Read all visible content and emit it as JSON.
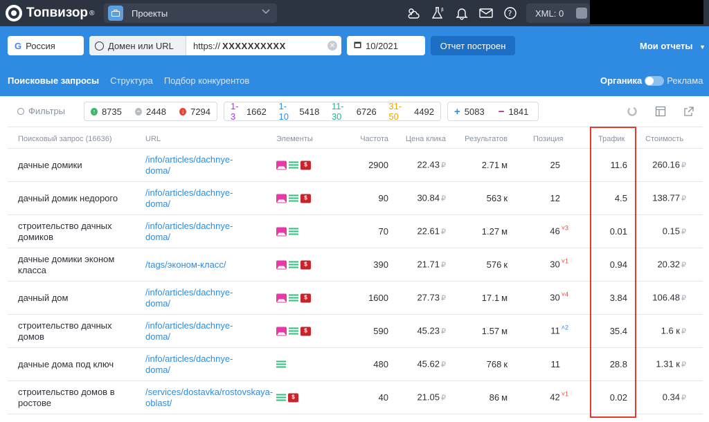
{
  "topbar": {
    "logo_text": "Топвизор",
    "logo_reg": "®",
    "project_label": "Проекты",
    "xml_label": "XML: 0",
    "icons": [
      "weather-icon",
      "flask-beta-icon",
      "bell-icon",
      "mail-icon",
      "help-icon"
    ]
  },
  "filterbar": {
    "country": "Россия",
    "domain_mode": "Домен или URL",
    "url_prefix": "https://",
    "url_value": "XXXXXXXXXX",
    "date": "10/2021",
    "report_button": "Отчет построен",
    "my_reports": "Мои отчеты"
  },
  "tabs": [
    {
      "label": "Поисковые запросы",
      "active": true
    },
    {
      "label": "Структура",
      "active": false
    },
    {
      "label": "Подбор конкурентов",
      "active": false
    }
  ],
  "toggle": {
    "left": "Органика",
    "right": "Реклама"
  },
  "summary": {
    "filters_label": "Фильтры",
    "up": "8735",
    "same": "2448",
    "down": "7294",
    "r1_3_label": "1-3",
    "r1_3": "1662",
    "r1_10_label": "1-10",
    "r1_10": "5418",
    "r11_30_label": "11-30",
    "r11_30": "6726",
    "r31_50_label": "31-50",
    "r31_50": "4492",
    "added": "5083",
    "removed": "1841"
  },
  "table": {
    "headers": {
      "query": "Поисковый запрос (16636)",
      "url": "URL",
      "elements": "Элементы",
      "frequency": "Частота",
      "cpc": "Цена клика",
      "results": "Результатов",
      "position": "Позиция",
      "traffic": "Трафик",
      "cost": "Стоимость"
    },
    "currency": "₽",
    "rows": [
      {
        "query": "дачные домики",
        "url": "/info/articles/dachnye-doma/",
        "elements": [
          "image",
          "text",
          "ad"
        ],
        "freq": "2900",
        "cpc": "22.43",
        "res_num": "2.71",
        "res_unit": "м",
        "pos": "25",
        "delta": "",
        "traffic": "11.6",
        "cost": "260.16"
      },
      {
        "query": "дачный домик недорого",
        "url": "/info/articles/dachnye-doma/",
        "elements": [
          "image",
          "text",
          "ad"
        ],
        "freq": "90",
        "cpc": "30.84",
        "res_num": "563",
        "res_unit": "к",
        "pos": "12",
        "delta": "",
        "traffic": "4.5",
        "cost": "138.77"
      },
      {
        "query": "строительство дачных домиков",
        "url": "/info/articles/dachnye-doma/",
        "elements": [
          "image",
          "text"
        ],
        "freq": "70",
        "cpc": "22.61",
        "res_num": "1.27",
        "res_unit": "м",
        "pos": "46",
        "delta": "˅3",
        "traffic": "0.01",
        "cost": "0.15"
      },
      {
        "query": "дачные домики эконом класса",
        "url": "/tags/эконом-класс/",
        "elements": [
          "image",
          "text",
          "ad"
        ],
        "freq": "390",
        "cpc": "21.71",
        "res_num": "576",
        "res_unit": "к",
        "pos": "30",
        "delta": "˅1",
        "traffic": "0.94",
        "cost": "20.32"
      },
      {
        "query": "дачный дом",
        "url": "/info/articles/dachnye-doma/",
        "elements": [
          "image",
          "text",
          "ad"
        ],
        "freq": "1600",
        "cpc": "27.73",
        "res_num": "17.1",
        "res_unit": "м",
        "pos": "30",
        "delta": "˅4",
        "traffic": "3.84",
        "cost": "106.48"
      },
      {
        "query": "строительство дачных домов",
        "url": "/info/articles/dachnye-doma/",
        "elements": [
          "image",
          "text",
          "ad"
        ],
        "freq": "590",
        "cpc": "45.23",
        "res_num": "1.57",
        "res_unit": "м",
        "pos": "11",
        "delta": "˄2",
        "traffic": "35.4",
        "cost": "1.6 к"
      },
      {
        "query": "дачные дома под ключ",
        "url": "/info/articles/dachnye-doma/",
        "elements": [
          "text"
        ],
        "freq": "480",
        "cpc": "45.62",
        "res_num": "768",
        "res_unit": "к",
        "pos": "11",
        "delta": "",
        "traffic": "28.8",
        "cost": "1.31 к"
      },
      {
        "query": "строительство домов в ростове",
        "url": "/services/dostavka/rostovskaya-oblast/",
        "elements": [
          "text",
          "ad"
        ],
        "freq": "40",
        "cpc": "21.05",
        "res_num": "86",
        "res_unit": "м",
        "pos": "42",
        "delta": "˅1",
        "traffic": "0.02",
        "cost": "0.34"
      }
    ]
  },
  "colors": {
    "topbar": "#2c3341",
    "bluebar": "#2f8be2",
    "link": "#2f8be2",
    "highlight_border": "#e5392f"
  }
}
